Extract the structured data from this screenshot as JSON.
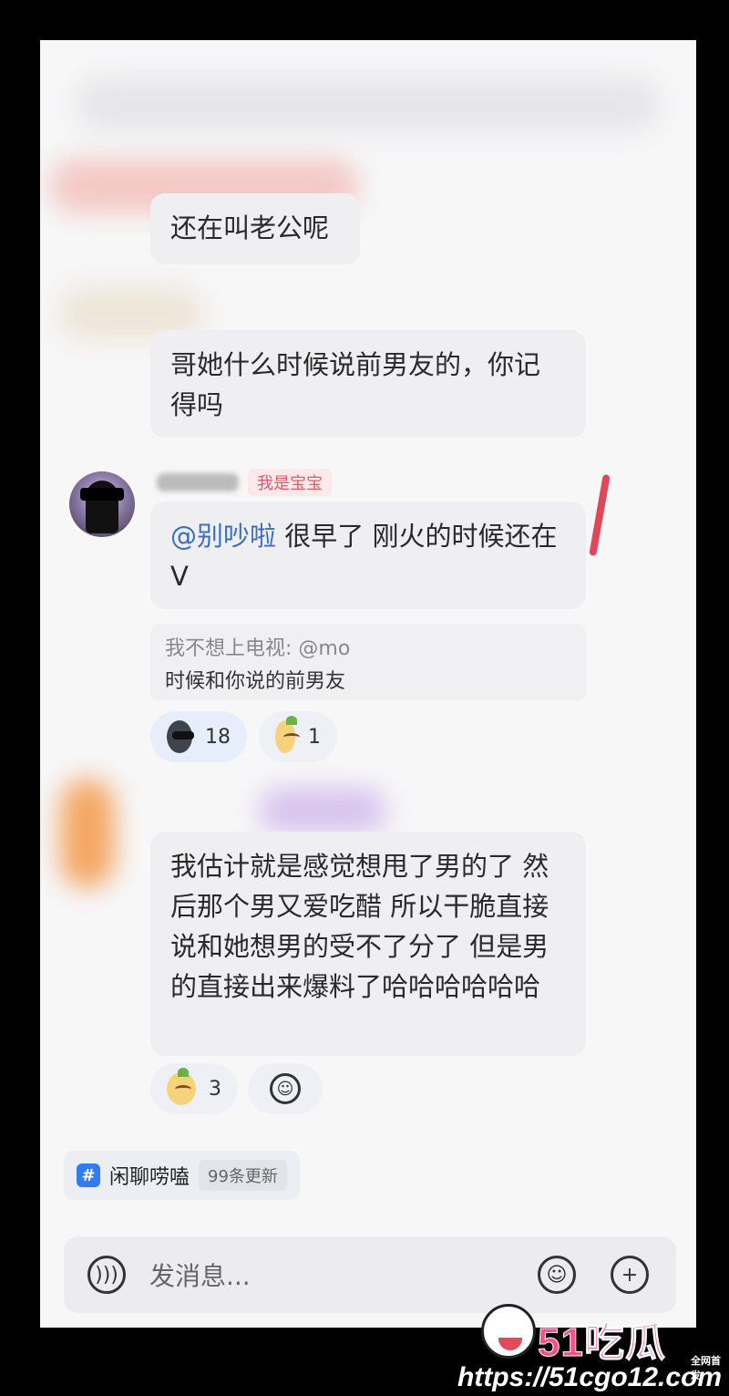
{
  "messages": {
    "m1": {
      "text": "还在叫老公呢"
    },
    "m2": {
      "text": "哥她什么时候说前男友的，你记得吗"
    },
    "m3": {
      "name_badge": "我是宝宝",
      "mention": "@别吵啦",
      "text": "很早了 刚火的时候还在V",
      "quote_author": "我不想上电视: @mo",
      "quote_text": "时候和你说的前男友",
      "reactions": [
        {
          "icon": "cool-face-emoji",
          "count": "18"
        },
        {
          "icon": "cute-face-emoji",
          "count": "1"
        }
      ]
    },
    "m4": {
      "text": "我估计就是感觉想甩了男的了 然后那个男又爱吃醋 所以干脆直接说和她想男的受不了分了 但是男的直接出来爆料了哈哈哈哈哈哈",
      "reactions": [
        {
          "icon": "cute-face-emoji",
          "count": "3"
        }
      ]
    }
  },
  "topic": {
    "hash": "#",
    "name": "闲聊唠嗑",
    "updates": "99条更新"
  },
  "input": {
    "placeholder": "发消息..."
  },
  "watermark": {
    "brand": "51吃瓜",
    "tag": "全网首发",
    "url": "https://51cgo12.com"
  }
}
